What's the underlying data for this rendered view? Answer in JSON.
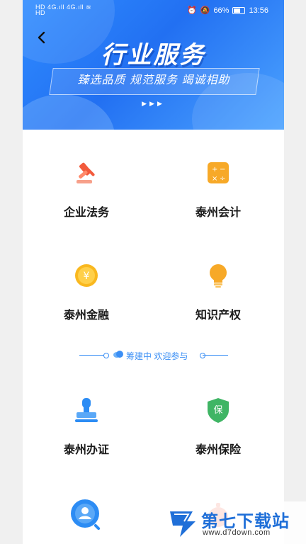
{
  "status_bar": {
    "left_top": "HD",
    "left_bottom": "HD",
    "signal_1": "4G",
    "signal_2": "4G",
    "battery_percent": "66%",
    "time": "13:56"
  },
  "header": {
    "back_icon": "chevron-left-icon",
    "title": "行业服务",
    "slogan": "臻选品质  规范服务  竭诚相助",
    "arrows": "▶▶▶"
  },
  "services": [
    {
      "label": "企业法务",
      "icon": "gavel-icon",
      "color": "#f25a3c"
    },
    {
      "label": "泰州会计",
      "icon": "calculator-icon",
      "color": "#f7a928"
    },
    {
      "label": "泰州金融",
      "icon": "yuan-coin-icon",
      "color": "#f9b81f"
    },
    {
      "label": "知识产权",
      "icon": "lightbulb-icon",
      "color": "#f7a928"
    }
  ],
  "divider": {
    "text": "筹建中 欢迎参与",
    "color": "#3b8ff5"
  },
  "upcoming": [
    {
      "label": "泰州办证",
      "icon": "stamp-icon",
      "color": "#2c8cf4"
    },
    {
      "label": "泰州保险",
      "icon": "insurance-shield-icon",
      "badge": "保",
      "color": "#3fb564"
    },
    {
      "label": "",
      "icon": "user-search-icon",
      "color": "#2c8cf4"
    },
    {
      "label": "",
      "icon": "alarm-icon",
      "color": "#f25a3c"
    }
  ],
  "watermark": {
    "title": "第七下载站",
    "url": "www.d7down.com"
  }
}
